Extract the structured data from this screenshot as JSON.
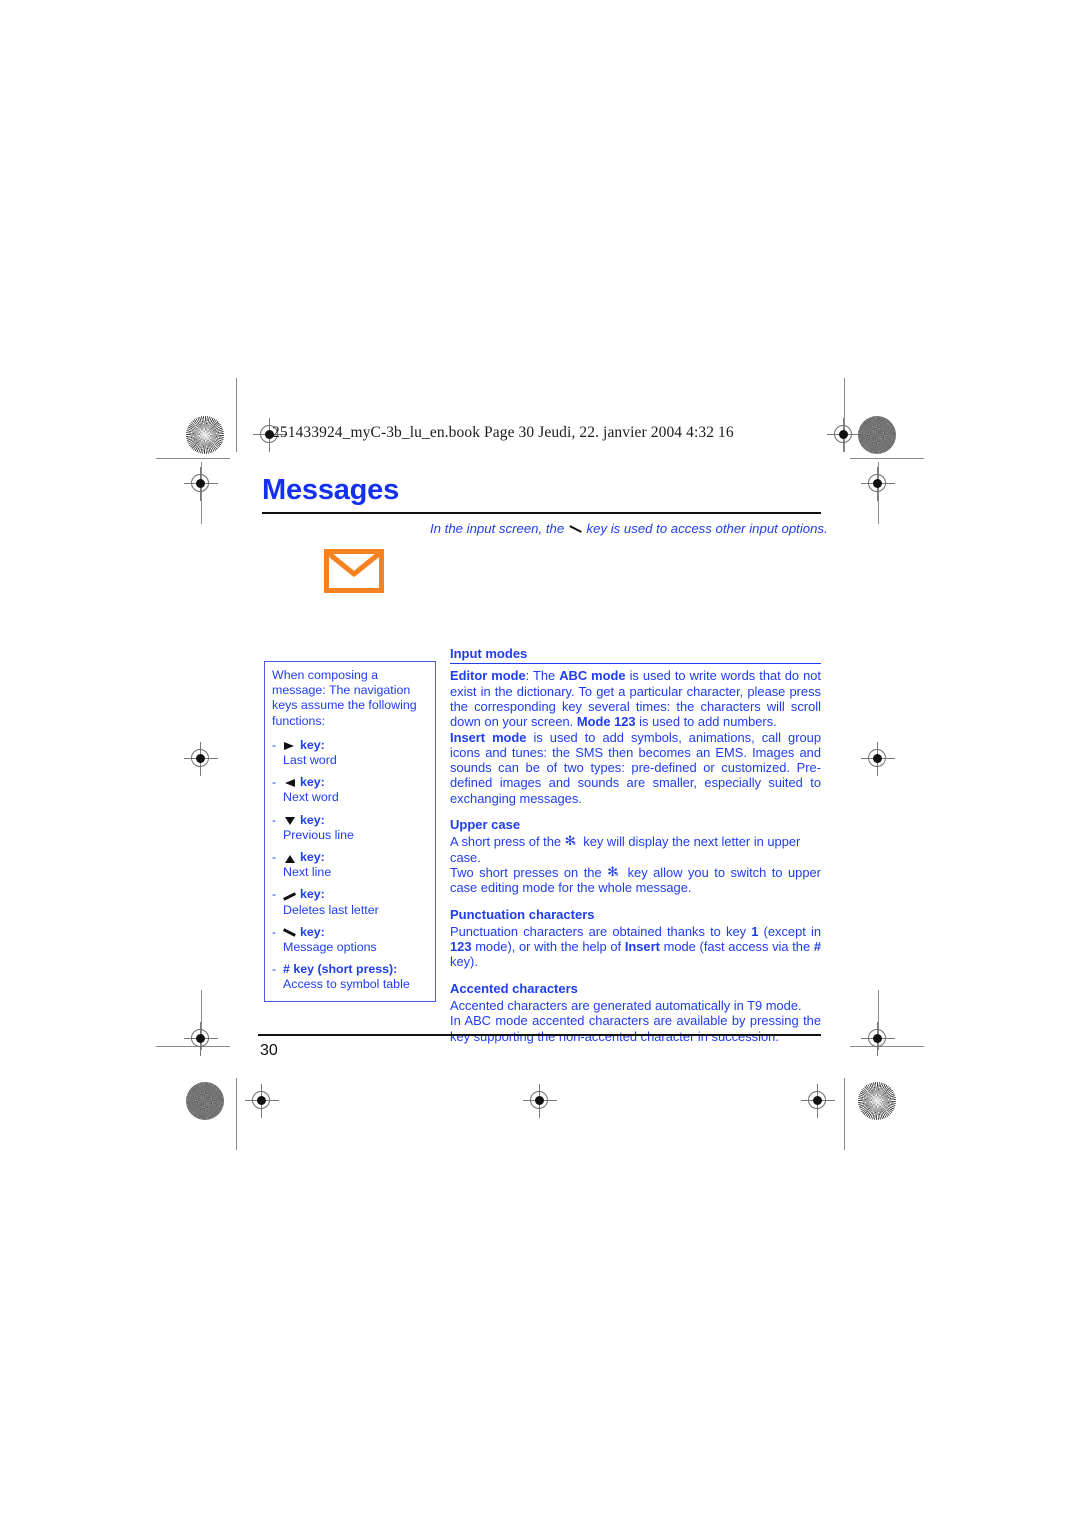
{
  "page": {
    "running_header": "251433924_myC-3b_lu_en.book  Page 30  Jeudi, 22. janvier 2004  4:32 16",
    "title": "Messages",
    "folio": "30",
    "intro_note_before": "In the input screen, the",
    "intro_note_after": "key is used to access other input options.",
    "envelope_icon": "envelope-icon",
    "colors": {
      "body_blue": "#1f3df0",
      "title_blue": "#1330f0",
      "envelope_orange": "#f58220",
      "rule_black": "#111111"
    }
  },
  "callout": {
    "lead_line1": "When composing a message:",
    "lead_line2": "The navigation keys assume the following functions:",
    "entries": [
      {
        "dash": "-",
        "glyph": "arrow-right-key-icon",
        "key_label": "key:",
        "desc": "Last word"
      },
      {
        "dash": "-",
        "glyph": "arrow-left-key-icon",
        "key_label": "key:",
        "desc": "Next word"
      },
      {
        "dash": "-",
        "glyph": "arrow-down-key-icon",
        "key_label": "key:",
        "desc": "Previous line"
      },
      {
        "dash": "-",
        "glyph": "arrow-up-key-icon",
        "key_label": "key:",
        "desc": "Next line"
      },
      {
        "dash": "-",
        "glyph": "slash-up-key-icon",
        "key_label": "key:",
        "desc": "Deletes last letter"
      },
      {
        "dash": "-",
        "glyph": "slash-down-key-icon",
        "key_label": "key:",
        "desc": "Message options"
      },
      {
        "dash": "-",
        "glyph": "",
        "key_label": "# key (short press):",
        "desc": "Access to symbol table"
      }
    ]
  },
  "sections": {
    "input_modes": {
      "heading": "Input modes",
      "editor_mode_label": "Editor mode",
      "editor_p1_a": ": The ",
      "abc_mode_label": "ABC mode",
      "editor_p1_b": " is used to write words that do not exist in the dictionary. To get a particular character, please press the corresponding key several times: the characters will scroll down on your screen. ",
      "mode123_label": "Mode 123",
      "editor_p1_c": " is used to add numbers.",
      "insert_mode_label": "Insert mode",
      "insert_p_a": " is used to add symbols, animations, call group icons and tunes: the SMS then becomes an EMS. Images and sounds can be of two types: pre-defined or customized. Pre-defined images and sounds are smaller, especially suited to exchanging messages."
    },
    "upper_case": {
      "heading": "Upper case",
      "line1_a": "A short press of the",
      "line1_b": "key will display the next letter in upper case.",
      "line2_a": "Two short presses on the",
      "line2_b": "key allow you to switch to upper case editing mode for the whole message."
    },
    "punctuation": {
      "heading": "Punctuation characters",
      "text_a": "Punctuation characters are obtained thanks to key ",
      "key1_label": "1",
      "text_b": " (except in ",
      "key123_label": "123",
      "text_c": " mode), or with the help of ",
      "insert_label": "Insert",
      "text_d": " mode (fast access via the ",
      "hash_label": "#",
      "text_e": " key)."
    },
    "accented": {
      "heading": "Accented characters",
      "line1": "Accented characters are generated automatically in T9 mode.",
      "line2": "In ABC mode accented characters are available by pressing the key supporting the non-accented character in succession."
    }
  }
}
